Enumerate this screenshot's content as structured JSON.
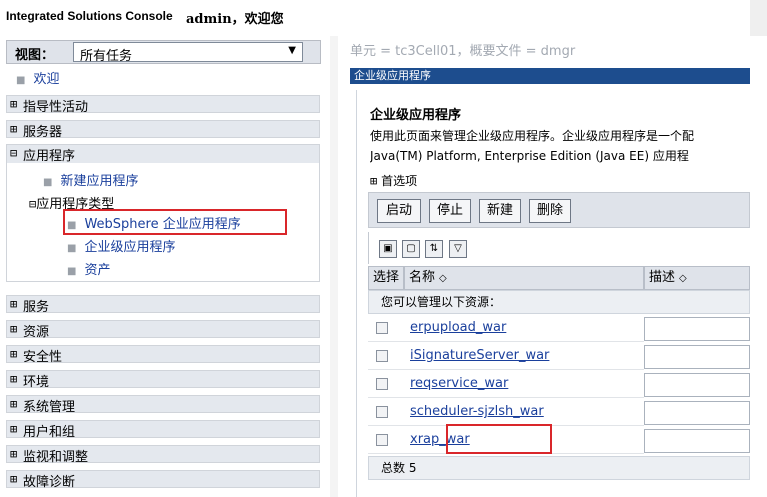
{
  "banner": {
    "console_title": "Integrated Solutions Console",
    "welcome": "admin，欢迎您"
  },
  "nav": {
    "view_label": "视图：",
    "view_value": "所有任务",
    "welcome_link": "欢迎",
    "groups": [
      {
        "pm": "⊞",
        "label": "指导性活动"
      },
      {
        "pm": "⊞",
        "label": "服务器"
      }
    ],
    "applications": {
      "pm": "⊟",
      "label": "应用程序",
      "new_app": "新建应用程序",
      "types_pm": "⊟",
      "types_label": "应用程序类型",
      "items": [
        "WebSphere 企业应用程序",
        "企业级应用程序",
        "资产"
      ]
    },
    "groups_after": [
      {
        "pm": "⊞",
        "label": "服务"
      },
      {
        "pm": "⊞",
        "label": "资源"
      },
      {
        "pm": "⊞",
        "label": "安全性"
      },
      {
        "pm": "⊞",
        "label": "环境"
      },
      {
        "pm": "⊞",
        "label": "系统管理"
      },
      {
        "pm": "⊞",
        "label": "用户和组"
      },
      {
        "pm": "⊞",
        "label": "监视和调整"
      },
      {
        "pm": "⊞",
        "label": "故障诊断"
      }
    ]
  },
  "main": {
    "breadcrumb": "单元 = tc3Cell01，概要文件 = dmgr",
    "section_title": "企业级应用程序",
    "heading": "企业级应用程序",
    "desc_line1": "使用此页面来管理企业级应用程序。企业级应用程序是一个配",
    "desc_line2": "Java(TM) Platform, Enterprise Edition (Java EE) 应用程",
    "preferences": "首选项",
    "preferences_pm": "⊞",
    "buttons": {
      "start": "启动",
      "stop": "停止",
      "new": "新建",
      "delete": "删除"
    },
    "table": {
      "col_select": "选择",
      "col_name": "名称",
      "col_desc": "描述",
      "sort_glyph": "◇",
      "manage_text": "您可以管理以下资源：",
      "rows": [
        "erpupload_war",
        "iSignatureServer_war",
        "reqservice_war",
        "scheduler-sjzlsh_war",
        "xrap_war"
      ],
      "total_label": "总数 5"
    }
  }
}
